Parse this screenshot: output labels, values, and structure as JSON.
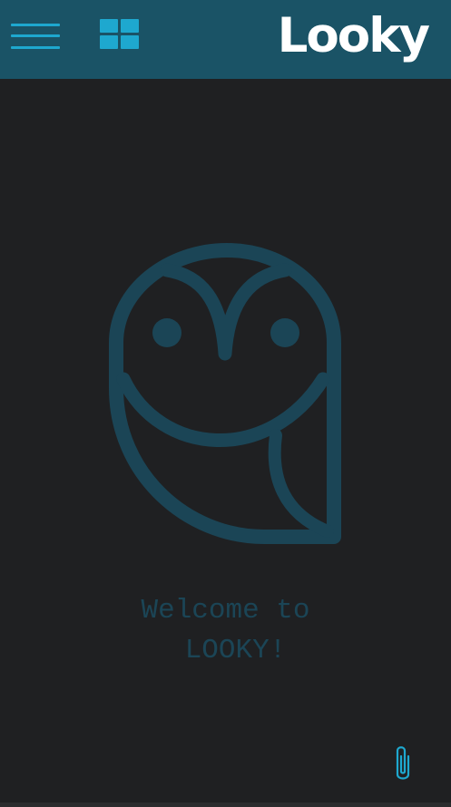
{
  "header": {
    "app_title": "Looky",
    "menu_icon": "hamburger-menu-icon",
    "grid_icon": "grid-view-icon"
  },
  "main": {
    "logo_icon": "owl-logo-icon",
    "welcome_line1": "Welcome to",
    "welcome_line2": "LOOKY!"
  },
  "footer": {
    "attach_icon": "paperclip-icon"
  },
  "colors": {
    "header_bg": "#1a5366",
    "page_bg": "#1f2022",
    "accent": "#1ea8cf",
    "logo": "#1b4556",
    "title_text": "#ffffff"
  }
}
